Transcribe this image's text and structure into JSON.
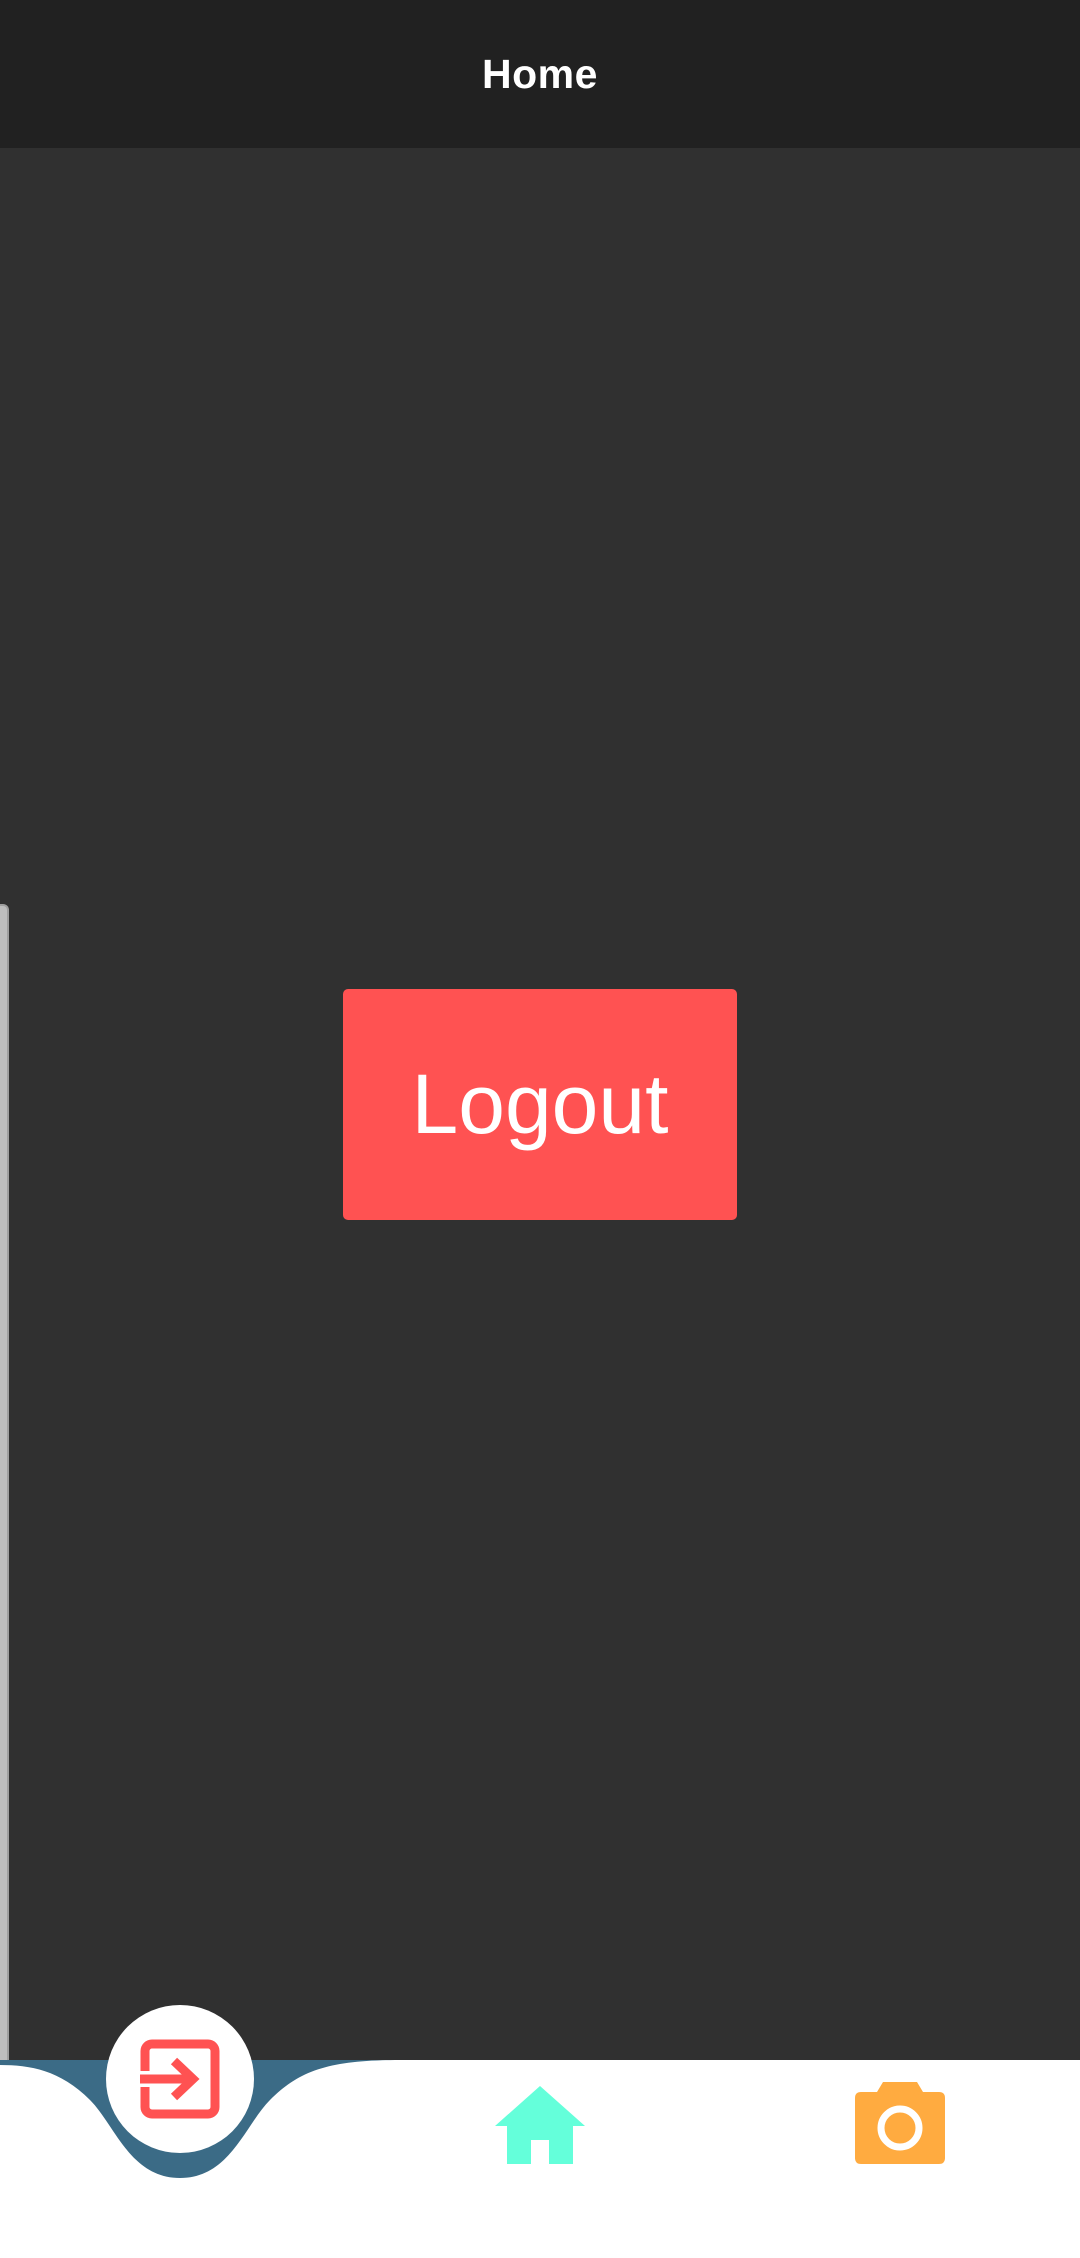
{
  "app_bar": {
    "title": "Home"
  },
  "main": {
    "logout_label": "Logout"
  },
  "bottom_nav": {
    "items": [
      {
        "icon": "login-icon",
        "color": "#ff5252",
        "active": true
      },
      {
        "icon": "home-icon",
        "color": "#64ffda",
        "active": false
      },
      {
        "icon": "camera-icon",
        "color": "#ffab40",
        "active": false
      }
    ],
    "active_background": "#3b6b86"
  },
  "colors": {
    "app_bar": "#212121",
    "background": "#303030",
    "logout_button": "#ff5252",
    "nav_background": "#ffffff"
  }
}
